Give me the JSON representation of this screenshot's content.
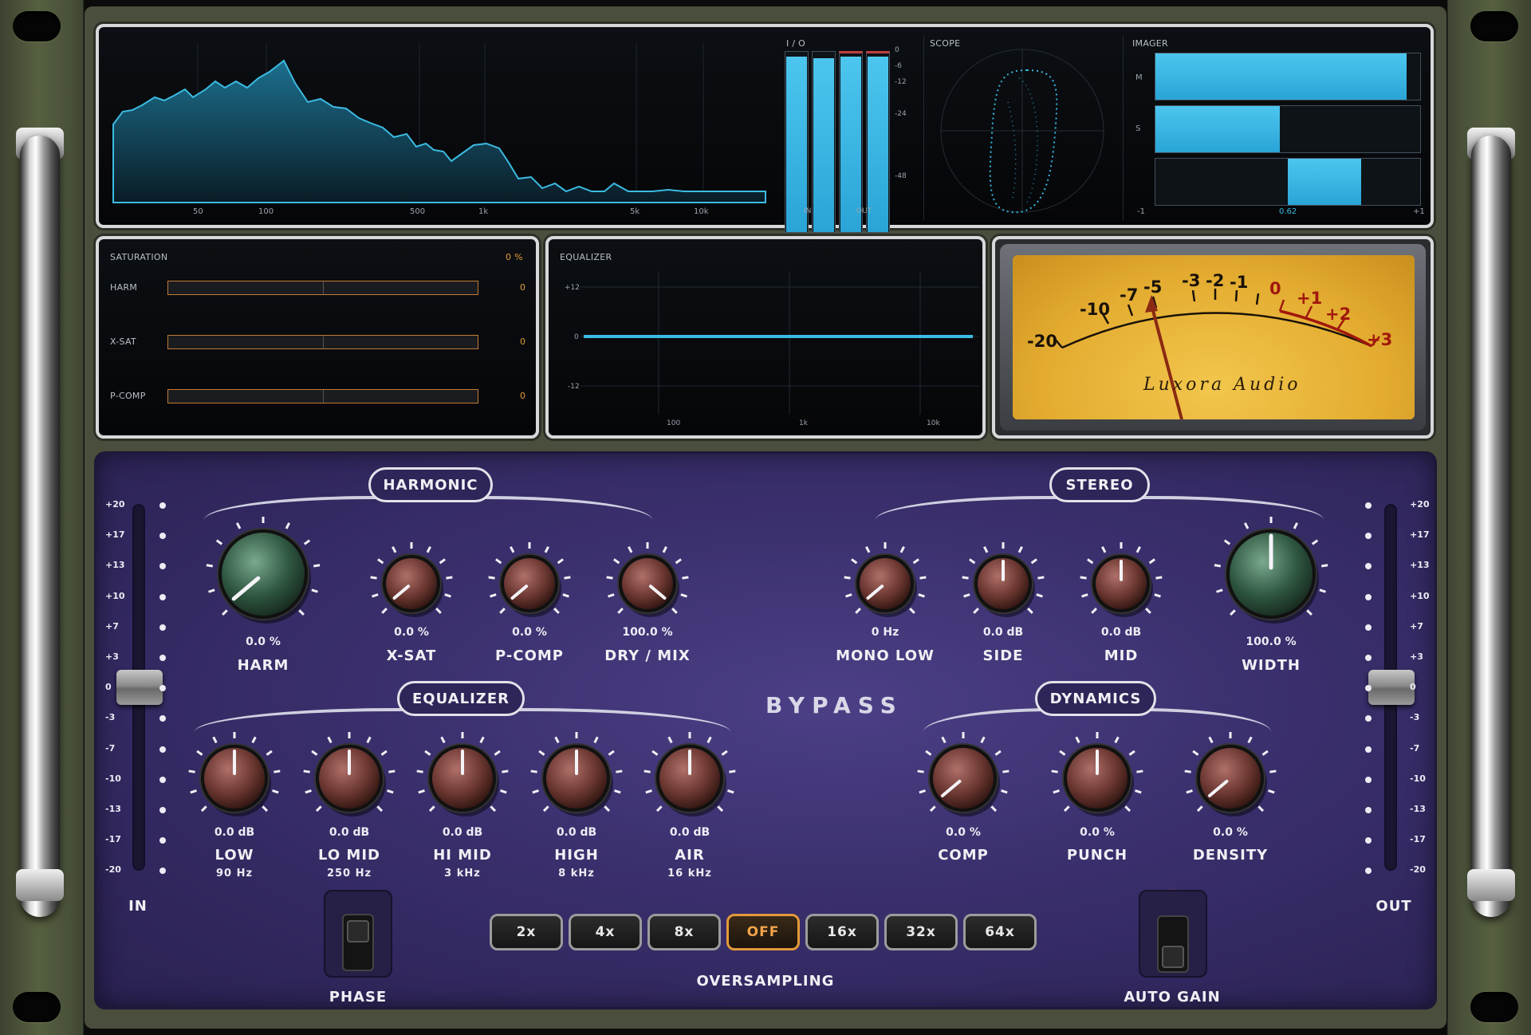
{
  "spectrum": {
    "freq_labels": [
      "50",
      "100",
      "500",
      "1k",
      "5k",
      "10k"
    ]
  },
  "io": {
    "label": "I / O",
    "scale": [
      "0",
      "-6",
      "-12",
      "-24",
      "-48"
    ],
    "in_label": "IN",
    "out_label": "OUT"
  },
  "scope": {
    "label": "SCOPE"
  },
  "imager": {
    "label": "IMAGER",
    "rows": [
      "M",
      "S"
    ],
    "min": "-1",
    "max": "+1",
    "value": "0.62",
    "m_level": 0.95,
    "s_level": 0.47,
    "balance_level": 0.62
  },
  "saturation": {
    "label": "SATURATION",
    "amount": "0 %",
    "rows": [
      {
        "name": "HARM",
        "value": "0"
      },
      {
        "name": "X-SAT",
        "value": "0"
      },
      {
        "name": "P-COMP",
        "value": "0"
      }
    ]
  },
  "equalizer_display": {
    "label": "EQUALIZER",
    "y_labels": [
      "+12",
      "0",
      "-12"
    ],
    "x_labels": [
      "100",
      "1k",
      "10k"
    ]
  },
  "vu_meter": {
    "scale": [
      "-20",
      "-10",
      "-7",
      "-5",
      "-3",
      "-2",
      "-1",
      "0",
      "+1",
      "+2",
      "+3"
    ],
    "brand": "Luxora Audio"
  },
  "sections": {
    "harmonic": "HARMONIC",
    "stereo": "STEREO",
    "equalizer": "EQUALIZER",
    "dynamics": "DYNAMICS"
  },
  "knobs": {
    "harm": {
      "value": "0.0 %",
      "label": "HARM"
    },
    "xsat": {
      "value": "0.0 %",
      "label": "X-SAT"
    },
    "pcomp": {
      "value": "0.0 %",
      "label": "P-COMP"
    },
    "drymix": {
      "value": "100.0 %",
      "label": "DRY / MIX"
    },
    "monolow": {
      "value": "0 Hz",
      "label": "MONO LOW"
    },
    "side": {
      "value": "0.0 dB",
      "label": "SIDE"
    },
    "mid": {
      "value": "0.0 dB",
      "label": "MID"
    },
    "width": {
      "value": "100.0 %",
      "label": "WIDTH"
    },
    "low": {
      "value": "0.0 dB",
      "label": "LOW",
      "sub": "90 Hz"
    },
    "lomid": {
      "value": "0.0 dB",
      "label": "LO MID",
      "sub": "250 Hz"
    },
    "himid": {
      "value": "0.0 dB",
      "label": "HI MID",
      "sub": "3 kHz"
    },
    "high": {
      "value": "0.0 dB",
      "label": "HIGH",
      "sub": "8 kHz"
    },
    "air": {
      "value": "0.0 dB",
      "label": "AIR",
      "sub": "16 kHz"
    },
    "comp": {
      "value": "0.0 %",
      "label": "COMP"
    },
    "punch": {
      "value": "0.0 %",
      "label": "PUNCH"
    },
    "density": {
      "value": "0.0 %",
      "label": "DENSITY"
    }
  },
  "fader_scale": [
    "+20",
    "+17",
    "+13",
    "+10",
    "+7",
    "+3",
    "0",
    "-3",
    "-7",
    "-10",
    "-13",
    "-17",
    "-20"
  ],
  "in_label": "IN",
  "out_label": "OUT",
  "bypass": "BYPASS",
  "oversampling": {
    "label": "OVERSAMPLING",
    "options": [
      "2x",
      "4x",
      "8x",
      "OFF",
      "16x",
      "32x",
      "64x"
    ],
    "selected": "OFF"
  },
  "phase_label": "PHASE",
  "auto_gain_label": "AUTO GAIN"
}
